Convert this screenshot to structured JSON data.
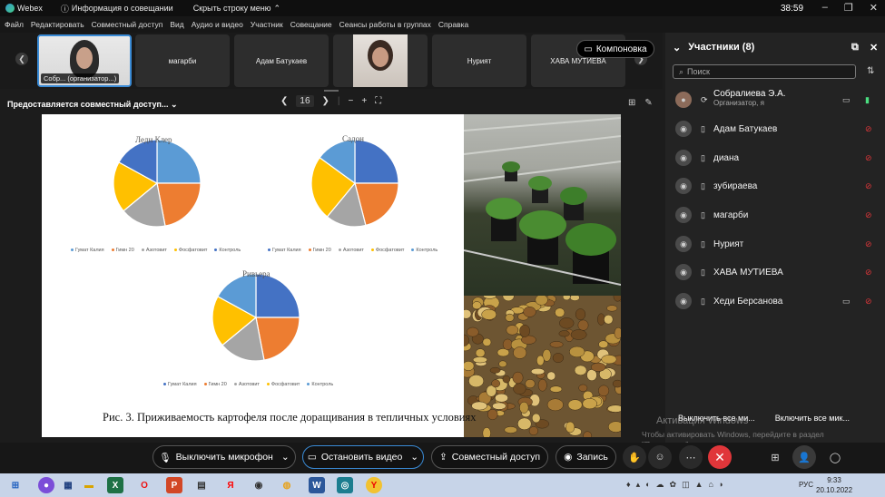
{
  "titlebar": {
    "app": "Webex",
    "meeting_info": "Информация о совещании",
    "hide_menu": "Скрыть строку меню",
    "time": "38:59"
  },
  "menu": [
    "Файл",
    "Редактировать",
    "Совместный доступ",
    "Вид",
    "Аудио и видео",
    "Участник",
    "Совещание",
    "Сеансы работы в группах",
    "Справка"
  ],
  "strip": {
    "tiles": [
      {
        "label": "Собр... (организатор...)",
        "video": true
      },
      {
        "label": "магарби",
        "video": false
      },
      {
        "label": "Адам Батукаев",
        "video": false
      },
      {
        "label": "",
        "video": true
      },
      {
        "label": "Нурият",
        "video": false
      },
      {
        "label": "ХАВА МУТИЕВА",
        "video": false
      }
    ],
    "layout_label": "Компоновка"
  },
  "share": {
    "label": "Предоставляется совместный доступ...",
    "page": "16"
  },
  "slide": {
    "caption": "Рис. 3. Приживаемость картофеля после доращивания в тепличных условиях",
    "legend": [
      "Гумат Калия",
      "Гимн 20",
      "Азотовит",
      "Фосфатовит",
      "Контроль"
    ]
  },
  "chart_data": [
    {
      "type": "pie",
      "title": "Леди Клер",
      "categories": [
        "Гумат Калия",
        "Гимн 20",
        "Азотовит",
        "Фосфатовит",
        "Контроль"
      ],
      "values": [
        25,
        22,
        17,
        19,
        17
      ],
      "colors": [
        "#5b9bd5",
        "#ed7d31",
        "#a5a5a5",
        "#ffc000",
        "#4472c4"
      ]
    },
    {
      "type": "pie",
      "title": "Садон",
      "categories": [
        "Гумат Калия",
        "Гимн 20",
        "Азотовит",
        "Фосфатовит",
        "Контроль"
      ],
      "values": [
        25,
        21,
        15,
        24,
        15
      ],
      "colors": [
        "#4472c4",
        "#ed7d31",
        "#a5a5a5",
        "#ffc000",
        "#5b9bd5"
      ]
    },
    {
      "type": "pie",
      "title": "Ривьера",
      "categories": [
        "Гумат Калия",
        "Гимн 20",
        "Азотовит",
        "Фосфатовит",
        "Контроль"
      ],
      "values": [
        25,
        22,
        17,
        19,
        17
      ],
      "colors": [
        "#4472c4",
        "#ed7d31",
        "#a5a5a5",
        "#ffc000",
        "#5b9bd5"
      ]
    }
  ],
  "controls": {
    "mic": "Выключить микрофон",
    "video": "Остановить видео",
    "share": "Совместный доступ",
    "record": "Запись"
  },
  "panel": {
    "title": "Участники (8)",
    "search_placeholder": "Поиск",
    "participants": [
      {
        "name": "Собралиева Э.А.",
        "role": "Организатор, я"
      },
      {
        "name": "Адам Батукаев",
        "role": ""
      },
      {
        "name": "диана",
        "role": ""
      },
      {
        "name": "зубираева",
        "role": ""
      },
      {
        "name": "магарби",
        "role": ""
      },
      {
        "name": "Нурият",
        "role": ""
      },
      {
        "name": "ХАВА МУТИЕВА",
        "role": ""
      },
      {
        "name": "Хеди Берсанова",
        "role": ""
      }
    ],
    "mute_all": "Выключить все ми...",
    "unmute_all": "Включить все мик..."
  },
  "watermark": {
    "line1": "Активация Windows",
    "line2": "Чтобы активировать Windows, перейдите в раздел \"Параметры\"."
  },
  "taskbar": {
    "lang": "РУС",
    "time": "9:33",
    "date": "20.10.2022"
  }
}
